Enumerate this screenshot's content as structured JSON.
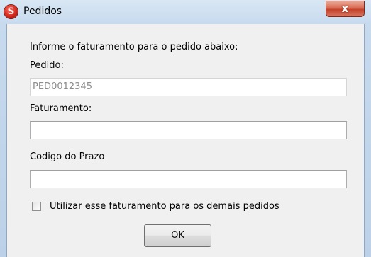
{
  "window": {
    "title": "Pedidos",
    "app_icon_letter": "S",
    "close_symbol": "x"
  },
  "form": {
    "instruction": "Informe o faturamento para o pedido abaixo:",
    "pedido_label": "Pedido:",
    "pedido_value": "PED0012345",
    "faturamento_label": "Faturamento:",
    "faturamento_value": "",
    "prazo_label": "Codigo do Prazo",
    "prazo_value": "",
    "checkbox_label": "Utilizar esse faturamento para os demais pedidos",
    "checkbox_checked": false,
    "ok_label": "OK"
  },
  "colors": {
    "close_button": "#c4412a",
    "frame": "#c7daee",
    "client": "#f0f0f0"
  }
}
